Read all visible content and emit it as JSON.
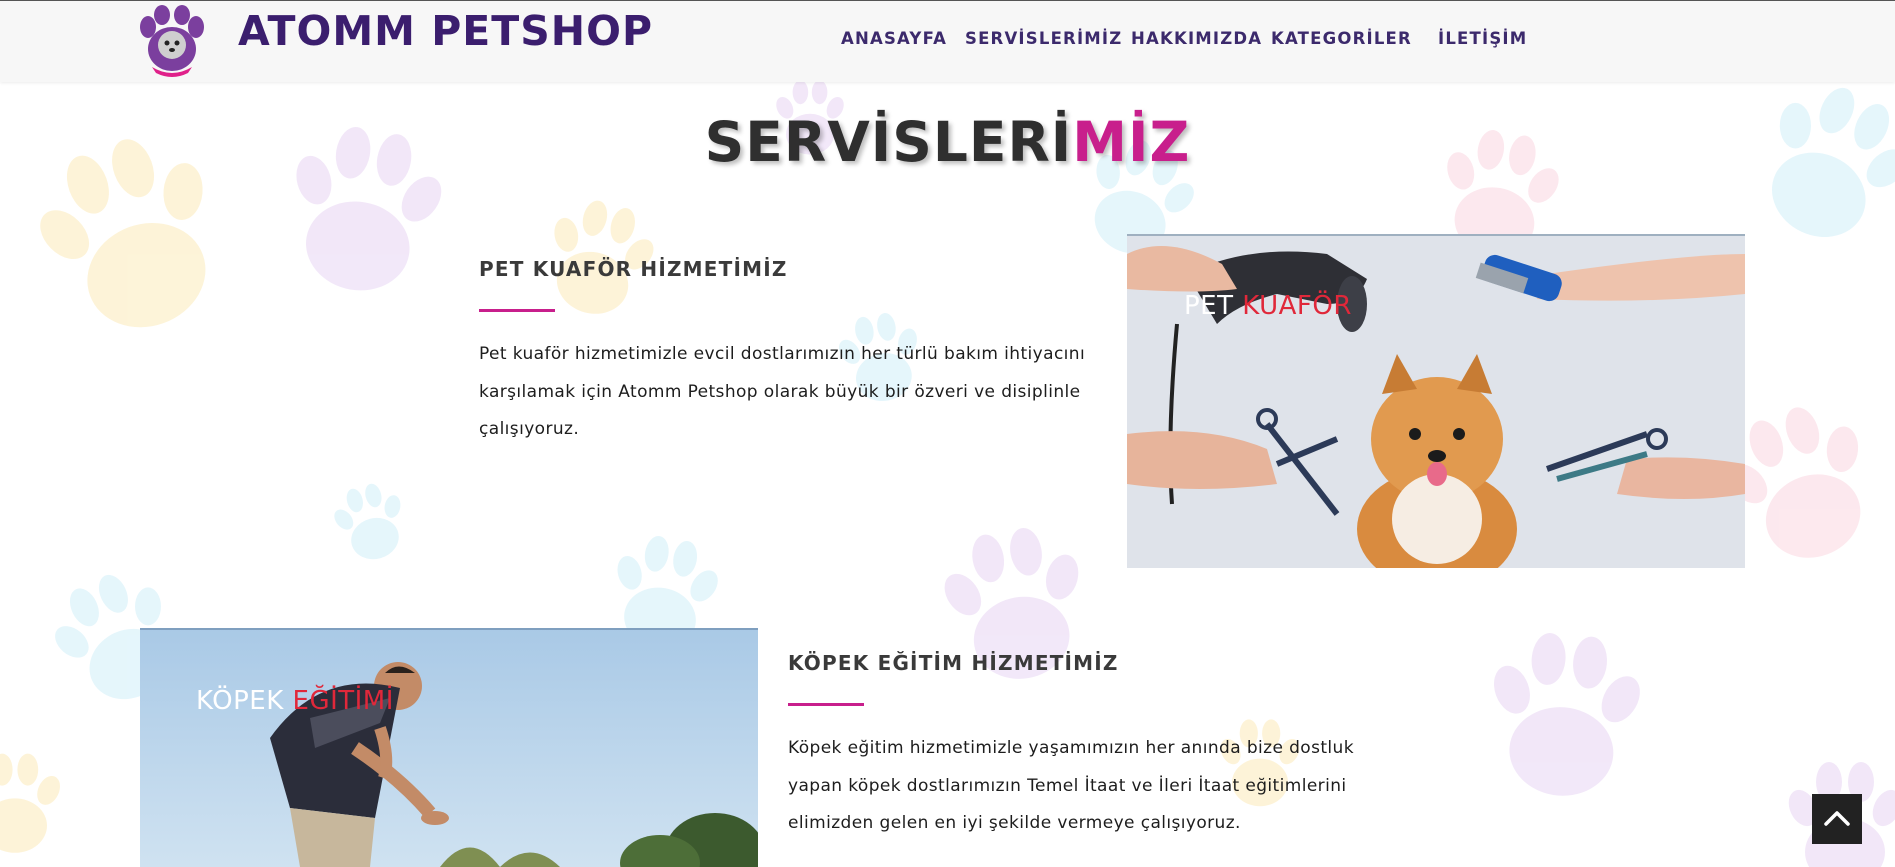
{
  "header": {
    "logo_alt": "Atomm Petshop logo",
    "brand": "ATOMM PETSHOP",
    "nav": [
      "ANASAYFA",
      "SERVİSLERİMİZ",
      "HAKKIMIZDA",
      "KATEGORİLER",
      "İLETİŞİM"
    ]
  },
  "section": {
    "title_part1": "SERVİSLERİ",
    "title_part2": "MİZ"
  },
  "services": [
    {
      "heading": "PET KUAFÖR HİZMETİMİZ",
      "text": "Pet kuaför hizmetimizle evcil dostlarımızın her türlü bakım ihtiyacını karşılamak için Atomm Petshop olarak büyük bir özveri ve disiplinle çalışıyoruz.",
      "caption_white": "PET ",
      "caption_red": "KUAFÖR"
    },
    {
      "heading": "KÖPEK EĞİTİM HİZMETİMİZ",
      "text": "Köpek eğitim hizmetimizle yaşamımızın her anında bize dostluk yapan köpek dostlarımızın Temel İtaat ve İleri İtaat eğitimlerini elimizden gelen en iyi şekilde vermeye çalışıyoruz.",
      "caption_white": "KÖPEK ",
      "caption_red": "EĞİTİMİ"
    }
  ],
  "colors": {
    "brand_purple": "#3b1e6e",
    "accent_magenta": "#c81f8c",
    "caption_red": "#e0283a"
  },
  "icons": {
    "back_to_top": "chevron-up-icon"
  }
}
